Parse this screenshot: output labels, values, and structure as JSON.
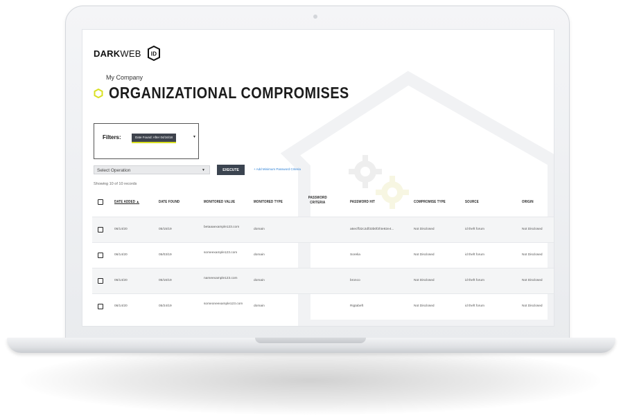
{
  "brand": {
    "logo_prefix": "DARK",
    "logo_suffix": "WEB",
    "badge": "ID"
  },
  "company": "My Company",
  "page_title": "ORGANIZATIONAL COMPROMISES",
  "filters": {
    "label": "Filters:",
    "chip": "Date Found: After 04/16/18"
  },
  "operation_select": "Select Operation",
  "execute_label": "EXECUTE",
  "add_criteria_link": "+ Add Minimum Password Criteria",
  "showing_text": "Showing 10 of 10 records",
  "columns": {
    "date_added": "DATE ADDED",
    "date_found": "DATE FOUND",
    "monitored_value": "MONITORED VALUE",
    "monitored_type": "MONITORED TYPE",
    "password_criteria": "PASSWORD CRITERIA",
    "password_hit": "PASSWORD HIT",
    "compromise_type": "COMPROMISE TYPE",
    "source": "SOURCE",
    "origin": "ORIGIN"
  },
  "sort_indicator": "▲",
  "rows": [
    {
      "date_added": "06/14/20",
      "date_found": "05/15/19",
      "monitored_value": "betaaaexample123.com",
      "monitored_type": "domain",
      "password_criteria": "",
      "password_hit": "a6ecff32c2df33b0f2f4e82e4...",
      "compromise_type": "Not Disclosed",
      "source": "id theft forum",
      "origin": "Not Disclosed"
    },
    {
      "date_added": "06/14/20",
      "date_found": "05/03/19",
      "monitored_value": "someexample123.com",
      "monitored_type": "domain",
      "password_criteria": "",
      "password_hit": "Sorelia",
      "compromise_type": "Not Disclosed",
      "source": "id theft forum",
      "origin": "Not Disclosed"
    },
    {
      "date_added": "06/14/20",
      "date_found": "05/16/19",
      "monitored_value": "nameexample123.com",
      "monitored_type": "domain",
      "password_criteria": "",
      "password_hit": "bronco",
      "compromise_type": "Not Disclosed",
      "source": "id theft forum",
      "origin": "Not Disclosed"
    },
    {
      "date_added": "06/14/20",
      "date_found": "05/24/19",
      "monitored_value": "someoneexample123.com",
      "monitored_type": "domain",
      "password_criteria": "",
      "password_hit": "Rigtabeft",
      "compromise_type": "Not Disclosed",
      "source": "id theft forum",
      "origin": "Not Disclosed"
    }
  ],
  "colors": {
    "accent_yellow": "#d9e021",
    "button_dark": "#3b4450",
    "link_blue": "#2a7fd6"
  }
}
